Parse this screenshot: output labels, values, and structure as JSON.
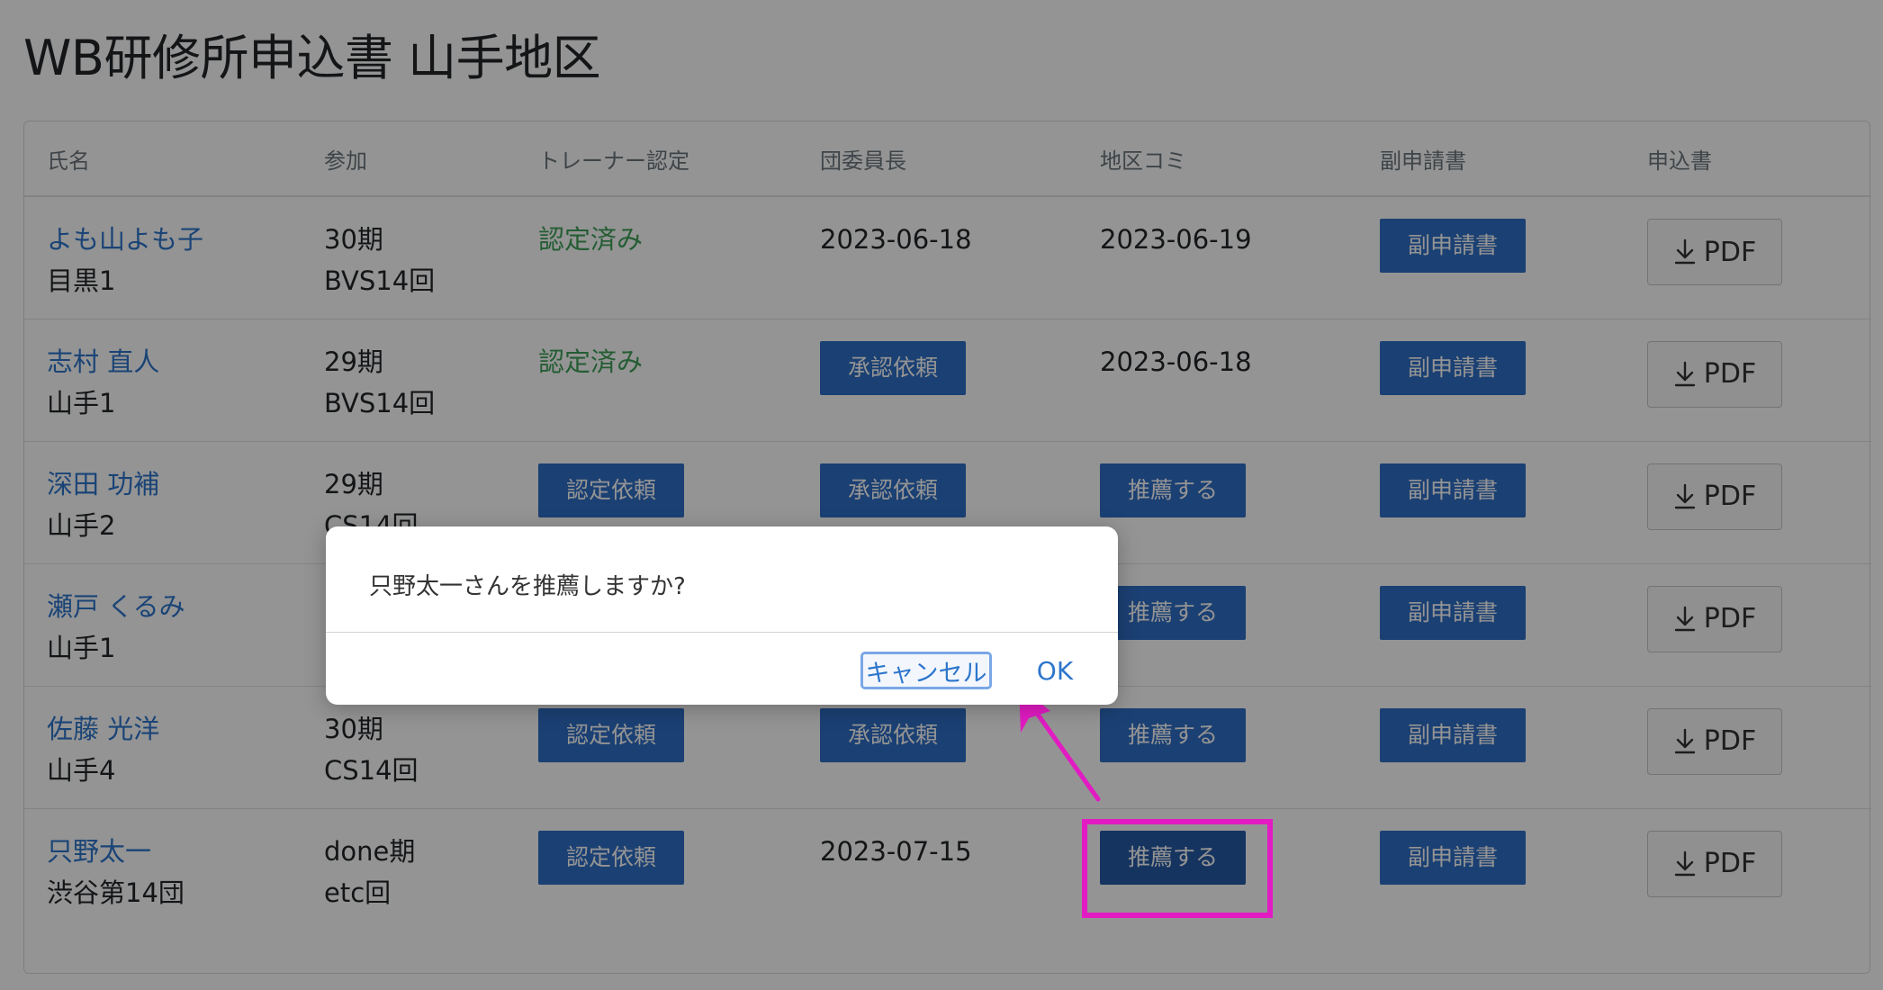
{
  "page": {
    "title": "WB研修所申込書 山手地区"
  },
  "table": {
    "headers": [
      "氏名",
      "参加",
      "トレーナー認定",
      "団委員長",
      "地区コミ",
      "副申請書",
      "申込書"
    ],
    "rows": [
      {
        "name": "よも山よも子",
        "group": "目黒1",
        "term": "30期",
        "course": "BVS14回",
        "trainer": {
          "kind": "text",
          "value": "認定済み"
        },
        "chair": {
          "kind": "text",
          "value": "2023-06-18"
        },
        "district": {
          "kind": "text",
          "value": "2023-06-19"
        },
        "sub_app": "副申請書",
        "pdf": "PDF"
      },
      {
        "name": "志村 直人",
        "group": "山手1",
        "term": "29期",
        "course": "BVS14回",
        "trainer": {
          "kind": "text",
          "value": "認定済み"
        },
        "chair": {
          "kind": "button",
          "value": "承認依頼"
        },
        "district": {
          "kind": "text",
          "value": "2023-06-18"
        },
        "sub_app": "副申請書",
        "pdf": "PDF"
      },
      {
        "name": "深田 功補",
        "group": "山手2",
        "term": "29期",
        "course": "CS14回",
        "trainer": {
          "kind": "button",
          "value": "認定依頼"
        },
        "chair": {
          "kind": "button",
          "value": "承認依頼"
        },
        "district": {
          "kind": "button",
          "value": "推薦する"
        },
        "sub_app": "副申請書",
        "pdf": "PDF"
      },
      {
        "name": "瀬戸 くるみ",
        "group": "山手1",
        "term": "",
        "course": "",
        "trainer": {
          "kind": "none",
          "value": ""
        },
        "chair": {
          "kind": "none",
          "value": ""
        },
        "district": {
          "kind": "button",
          "value": "推薦する"
        },
        "sub_app": "副申請書",
        "pdf": "PDF"
      },
      {
        "name": "佐藤 光洋",
        "group": "山手4",
        "term": "30期",
        "course": "CS14回",
        "trainer": {
          "kind": "button",
          "value": "認定依頼"
        },
        "chair": {
          "kind": "button",
          "value": "承認依頼"
        },
        "district": {
          "kind": "button",
          "value": "推薦する"
        },
        "sub_app": "副申請書",
        "pdf": "PDF"
      },
      {
        "name": "只野太一",
        "group": "渋谷第14団",
        "term": "done期",
        "course": "etc回",
        "trainer": {
          "kind": "button",
          "value": "認定依頼"
        },
        "chair": {
          "kind": "text",
          "value": "2023-07-15"
        },
        "district": {
          "kind": "button",
          "value": "推薦する"
        },
        "sub_app": "副申請書",
        "pdf": "PDF"
      }
    ]
  },
  "dialog": {
    "message": "只野太一さんを推薦しますか?",
    "cancel_label": "キャンセル",
    "ok_label": "OK"
  },
  "colors": {
    "link": "#2d76cc",
    "button": "#2f6fc7",
    "success": "#3fa159",
    "annotation": "#e21bc3"
  }
}
